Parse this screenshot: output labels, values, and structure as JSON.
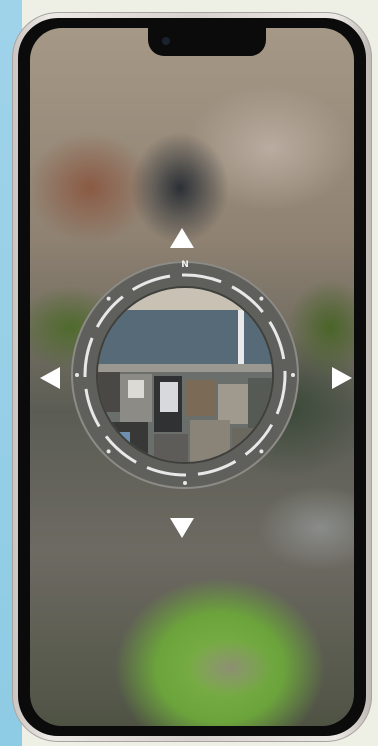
{
  "compass": {
    "north_label": "N"
  },
  "controls": {
    "up_icon": "triangle-up",
    "down_icon": "triangle-down",
    "left_icon": "triangle-left",
    "right_icon": "triangle-right"
  },
  "colors": {
    "arrow": "#ffffff",
    "compass_ring": "#5f5f5b",
    "compass_marks": "#e8e8e8"
  }
}
